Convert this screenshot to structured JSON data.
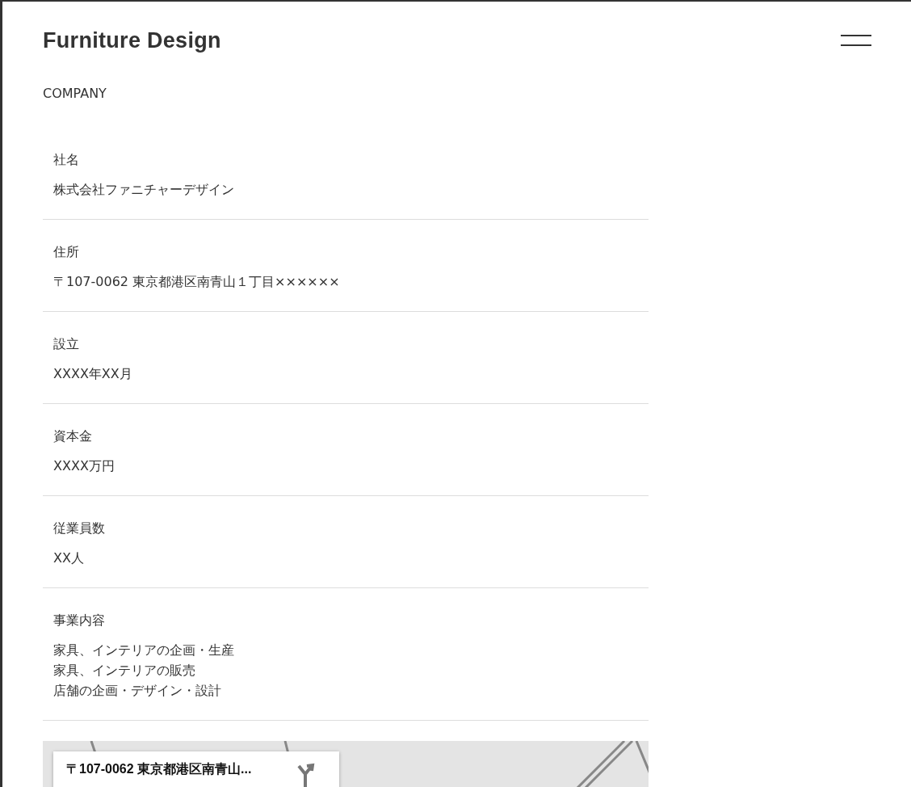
{
  "header": {
    "logo": "Furniture Design"
  },
  "section_title": "COMPANY",
  "rows": [
    {
      "label": "社名",
      "lines": [
        "株式会社ファニチャーデザイン"
      ]
    },
    {
      "label": "住所",
      "lines": [
        "〒107-0062 東京都港区南青山１丁目××××××"
      ]
    },
    {
      "label": "設立",
      "lines": [
        "XXXX年XX月"
      ]
    },
    {
      "label": "資本金",
      "lines": [
        "XXXX万円"
      ]
    },
    {
      "label": "従業員数",
      "lines": [
        "XX人"
      ]
    },
    {
      "label": "事業内容",
      "lines": [
        "家具、インテリアの企画・生産",
        "家具、インテリアの販売",
        "店舗の企画・デザイン・設計"
      ]
    }
  ],
  "map": {
    "card_title": "〒107-0062 東京都港区南青山..."
  }
}
